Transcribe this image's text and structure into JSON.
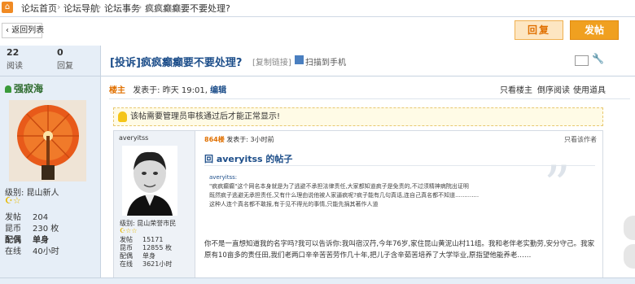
{
  "breadcrumb": {
    "items": [
      "论坛首页",
      "论坛导航",
      "论坛事务",
      "疯疯癫癫要不要处理?"
    ]
  },
  "actions": {
    "back_label": "返回列表",
    "reply_label": "回复",
    "post_label": "发帖"
  },
  "stats": {
    "views_num": "22",
    "views_label": "阅读",
    "replies_num": "0",
    "replies_label": "回复"
  },
  "thread": {
    "title": "[投诉]疯疯癫癫要不要处理?",
    "copy_link": "[复制链接]",
    "scan_label": "扫描到手机"
  },
  "author": {
    "name": "强寂海",
    "level_label": "级别: 昆山新人",
    "stars": "☪☆",
    "info": [
      {
        "key": "发帖",
        "value": "204"
      },
      {
        "key": "昆币",
        "value": "230 枚"
      },
      {
        "key": "配偶",
        "value": "单身"
      },
      {
        "key": "在线",
        "value": "40小时"
      }
    ]
  },
  "post_meta": {
    "lz": "楼主",
    "posted": "发表于: 昨天 19:01",
    "edit": "编辑",
    "only_lz": "只看楼主",
    "reverse": "倒序阅读",
    "tools": "使用道具"
  },
  "notice": {
    "text": "该帖需要管理员审核通过后才能正常显示!"
  },
  "inner_post": {
    "author": "averyitss",
    "level_label": "级别: 昆山荣誉市民",
    "stars": "☪☆☆",
    "info": [
      {
        "key": "发帖",
        "value": "15171"
      },
      {
        "key": "昆币",
        "value": "12855 枚"
      },
      {
        "key": "配偶",
        "value": "单身"
      },
      {
        "key": "在线",
        "value": "3621小时"
      }
    ],
    "floor": "864楼",
    "floor_meta": "发表于: 3小时前",
    "only_author": "只看该作者",
    "title": "回 averyitss 的帖子",
    "quote_who": "averyitss:",
    "quote_lines": [
      "\"疯疯癫癫\"这个网名本身就是为了逃避不承担法律责任,大家都知道疯子是免责的,不过须精神病院出证明",
      "既然疯子逃避无承担责任,又有什么理由说他被人家逼疯呢?疯子能有几句真话,连自己真名都不知道.............",
      "这种人连个真名都不敢报,有于见不得光的事情,只能先捐其著作人道"
    ],
    "body": "你不是一直想知道我的名字吗?我可以告诉你:我叫宿汉荇,今年76岁,家住昆山黄泥山村11组。我和老伴老实勤劳,安分守己。我家原有10亩多的责任田,我们老两口辛辛苦苦劳作几十年,把儿子含辛茹苦培养了大学毕业,原指望他能养老……"
  }
}
